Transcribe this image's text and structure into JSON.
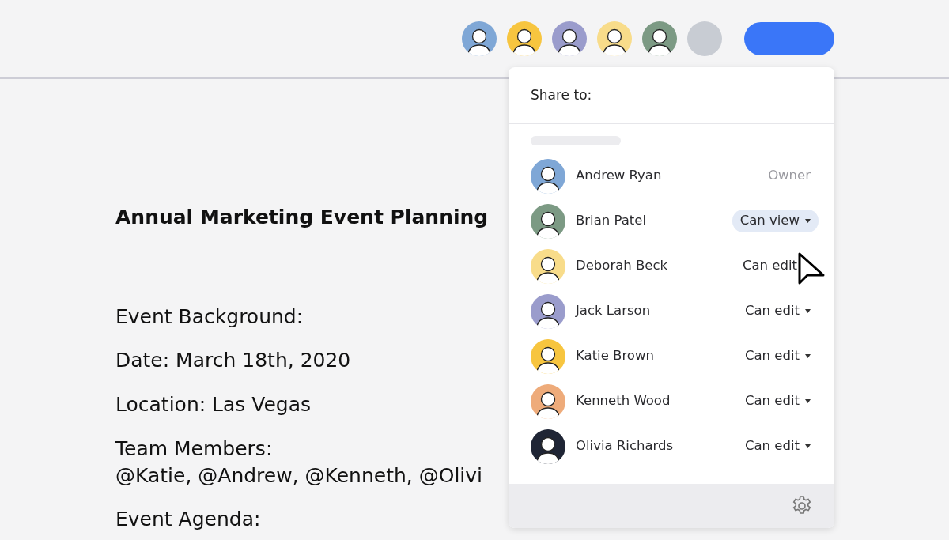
{
  "header": {
    "avatars": [
      {
        "color": "#7fa7d6",
        "person": true
      },
      {
        "color": "#f7c53f",
        "person": true
      },
      {
        "color": "#9a9ccc",
        "person": true
      },
      {
        "color": "#f8dc8a",
        "person": true
      },
      {
        "color": "#7c9a84",
        "person": true
      },
      {
        "color": "#c8ccd3",
        "person": false
      }
    ]
  },
  "document": {
    "title": "Annual Marketing Event Planning",
    "lines": [
      [
        "Event Background:"
      ],
      [
        "Date: March 18th, 2020"
      ],
      [
        "Location: Las Vegas"
      ],
      [
        "Team Members:",
        "@Katie, @Andrew, @Kenneth, @Olivi"
      ],
      [
        "Event Agenda:"
      ]
    ]
  },
  "share_panel": {
    "title": "Share to:",
    "people": [
      {
        "name": "Andrew Ryan",
        "color": "#7fa7d6",
        "permission": "Owner",
        "kind": "owner",
        "caret": false,
        "highlighted": false
      },
      {
        "name": "Brian Patel",
        "color": "#7c9a84",
        "permission": "Can view",
        "kind": "menu",
        "caret": true,
        "highlighted": true
      },
      {
        "name": "Deborah Beck",
        "color": "#f8dc8a",
        "permission": "Can edit",
        "kind": "menu",
        "caret": false,
        "highlighted": false
      },
      {
        "name": "Jack Larson",
        "color": "#9a9ccc",
        "permission": "Can edit",
        "kind": "menu",
        "caret": true,
        "highlighted": false
      },
      {
        "name": "Katie Brown",
        "color": "#f7c53f",
        "permission": "Can edit",
        "kind": "menu",
        "caret": true,
        "highlighted": false
      },
      {
        "name": "Kenneth Wood",
        "color": "#eeab7a",
        "permission": "Can edit",
        "kind": "menu",
        "caret": true,
        "highlighted": false
      },
      {
        "name": "Olivia Richards",
        "color": "#1f2535",
        "permission": "Can edit",
        "kind": "menu",
        "caret": true,
        "highlighted": false
      }
    ]
  }
}
